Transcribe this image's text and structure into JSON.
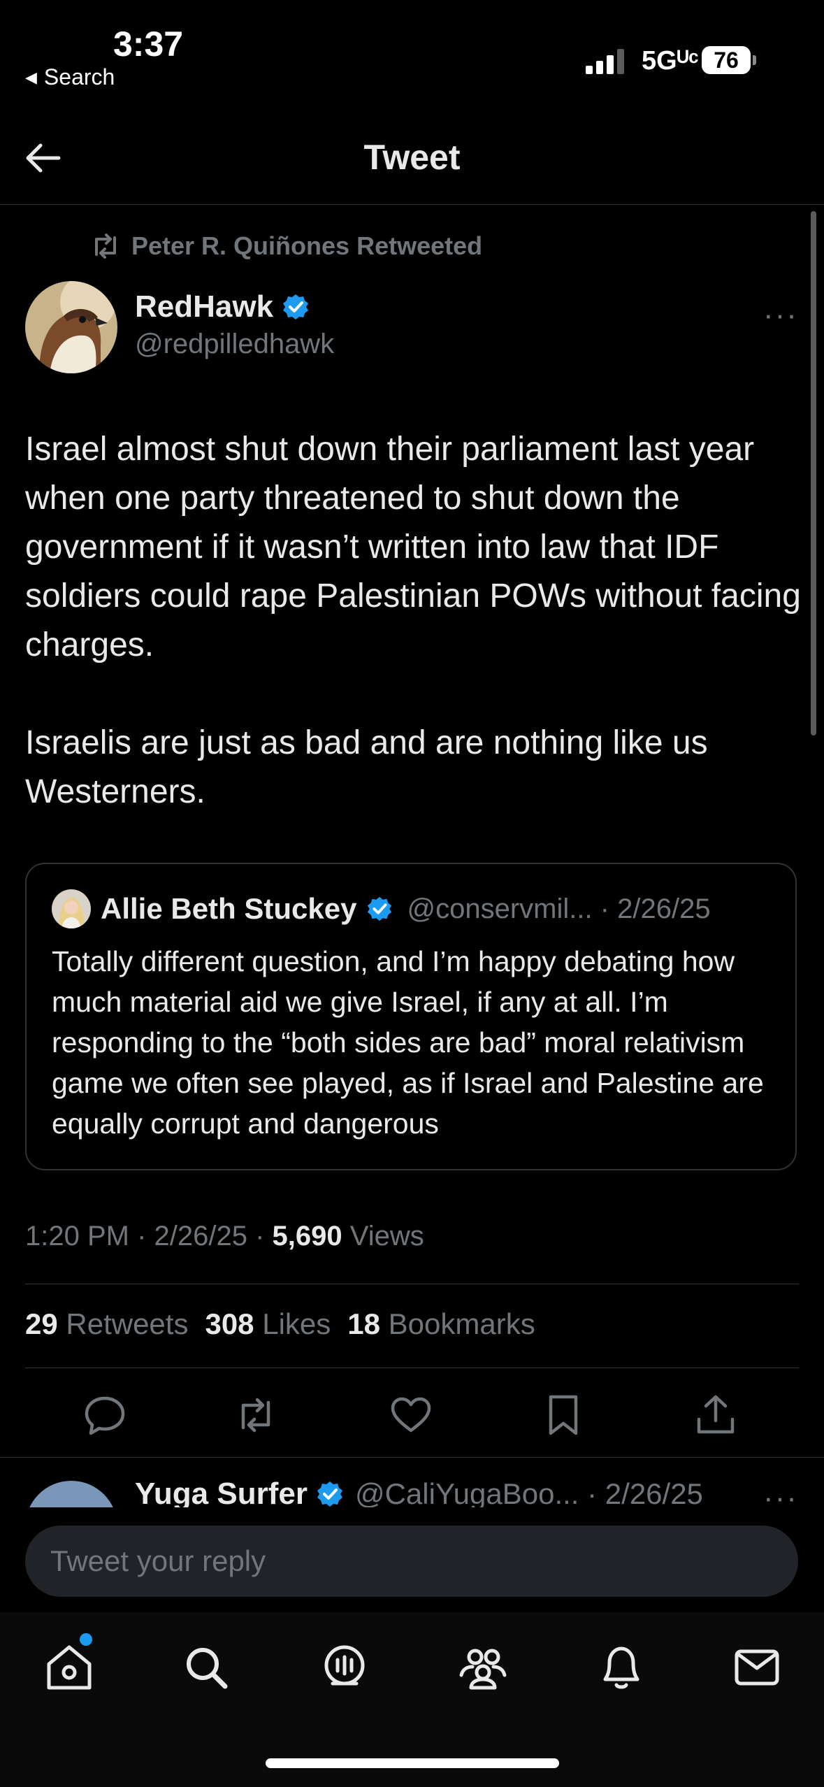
{
  "status_bar": {
    "time": "3:37",
    "back_label": "Search",
    "network": "5Gᵁᶜ",
    "battery": "76"
  },
  "header": {
    "title": "Tweet"
  },
  "tweet": {
    "retweeted_by": "Peter R. Quiñones Retweeted",
    "author_name": "RedHawk",
    "author_handle": "@redpilledhawk",
    "more": "···",
    "text": "Israel almost shut down their parliament last year when one party threatened to shut down the government if it wasn’t written into law that IDF soldiers could rape Palestinian POWs without facing charges.\n\nIsraelis are just as bad and are nothing like us Westerners.",
    "quote": {
      "author_name": "Allie Beth Stuckey",
      "author_handle": "@conservmil... · 2/26/25",
      "text": "Totally different question, and I’m happy debating how much material aid we give Israel, if any at all. I’m responding to the “both sides are bad” moral relativism game we often see played, as if Israel and Palestine are equally corrupt and dangerous"
    },
    "time": "1:20 PM · 2/26/25 · ",
    "views_count": "5,690",
    "views_label": " Views",
    "retweets_count": "29",
    "retweets_label": " Retweets",
    "likes_count": "308",
    "likes_label": " Likes",
    "bookmarks_count": "18",
    "bookmarks_label": " Bookmarks"
  },
  "reply_preview": {
    "author_name": "Yuga Surfer",
    "author_handle": "@CaliYugaBoo... · 2/26/25",
    "more": "···"
  },
  "composer": {
    "placeholder": "Tweet your reply"
  },
  "colors": {
    "background": "#000000",
    "text": "#e7e9ea",
    "muted": "#71767b",
    "accent": "#1d9bf0",
    "divider": "#2f3336"
  },
  "icons": {
    "actions": [
      "reply-icon",
      "retweet-icon",
      "like-icon",
      "bookmark-icon",
      "share-icon"
    ],
    "tabs": [
      "home-icon",
      "search-icon",
      "spaces-icon",
      "communities-icon",
      "notifications-icon",
      "messages-icon"
    ]
  }
}
